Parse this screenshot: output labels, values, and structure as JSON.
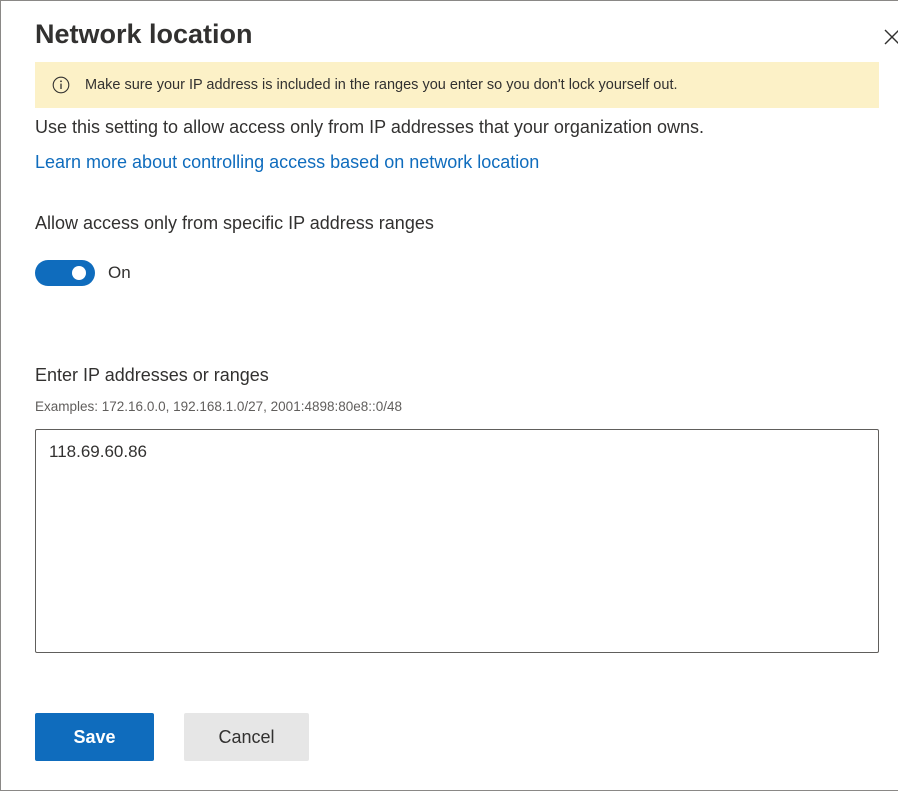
{
  "panel": {
    "title": "Network location"
  },
  "banner": {
    "icon": "info-icon",
    "text": "Make sure your IP address is included in the ranges you enter so you don't lock yourself out."
  },
  "description": "Use this setting to allow access only from IP addresses that your organization owns.",
  "learn_more_link": "Learn more about controlling access based on network location",
  "restriction": {
    "label": "Allow access only from specific IP address ranges",
    "toggle_on": true,
    "toggle_state_label": "On"
  },
  "ip_input": {
    "label": "Enter IP addresses or ranges",
    "examples": "Examples: 172.16.0.0, 192.168.1.0/27, 2001:4898:80e8::0/48",
    "value": "118.69.60.86"
  },
  "actions": {
    "save_label": "Save",
    "cancel_label": "Cancel"
  },
  "colors": {
    "accent": "#0f6cbd",
    "warning_banner": "#fcf1c7",
    "cancel_button": "#e6e6e6"
  }
}
